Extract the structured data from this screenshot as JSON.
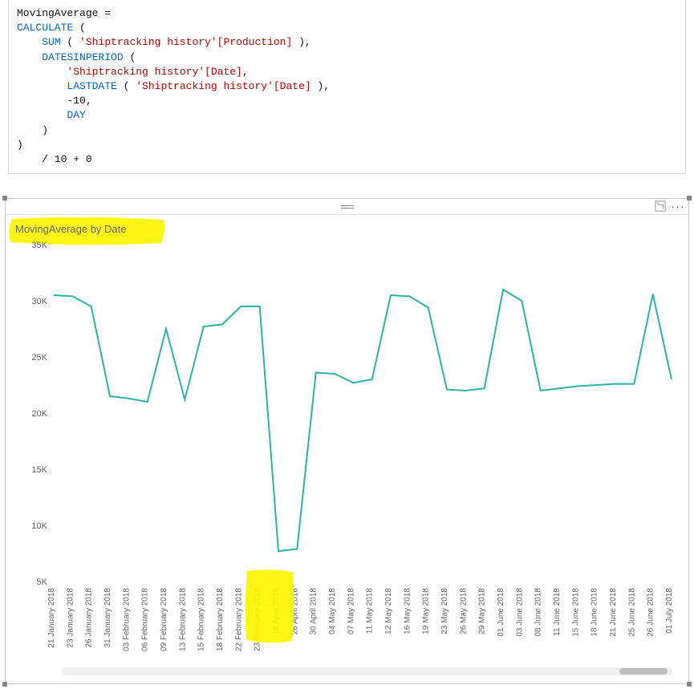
{
  "formula": {
    "line1_a": "MovingAverage",
    "line1_b": " = ",
    "line2_fn": "CALCULATE",
    "line2_b": " (",
    "line3_fn": "SUM",
    "line3_b": " ( ",
    "line3_str": "'Shiptracking history'[Production]",
    "line3_c": " ),",
    "line4_fn": "DATESINPERIOD",
    "line4_b": " (",
    "line5_str": "'Shiptracking history'[Date]",
    "line5_b": ",",
    "line6_fn": "LASTDATE",
    "line6_b": " ( ",
    "line6_str": "'Shiptracking history'[Date]",
    "line6_c": " ),",
    "line7_a": "-10,",
    "line8_fn": "DAY",
    "line9_a": ")",
    "line10_a": ")",
    "line11_a": "/ 10 + 0"
  },
  "visual": {
    "title": "MovingAverage by Date"
  },
  "chart_data": {
    "type": "line",
    "title": "MovingAverage by Date",
    "xlabel": "",
    "ylabel": "",
    "ylim": [
      5000,
      35000
    ],
    "y_ticks": [
      5000,
      10000,
      15000,
      20000,
      25000,
      30000,
      35000
    ],
    "y_tick_labels": [
      "5K",
      "10K",
      "15K",
      "20K",
      "25K",
      "30K",
      "35K"
    ],
    "categories": [
      "21 January 2018",
      "23 January 2018",
      "26 January 2018",
      "31 January 2018",
      "03 February 2018",
      "06 February 2018",
      "09 February 2018",
      "13 February 2018",
      "15 February 2018",
      "18 February 2018",
      "22 February 2018",
      "23 February 2018",
      "16 April 2018",
      "26 April 2018",
      "30 April 2018",
      "04 May 2018",
      "07 May 2018",
      "11 May 2018",
      "12 May 2018",
      "16 May 2018",
      "19 May 2018",
      "23 May 2018",
      "26 May 2018",
      "29 May 2018",
      "01 June 2018",
      "03 June 2018",
      "08 June 2018",
      "11 June 2018",
      "15 June 2018",
      "18 June 2018",
      "21 June 2018",
      "25 June 2018",
      "26 June 2018",
      "01 July 2018"
    ],
    "values": [
      30500,
      30400,
      29500,
      21500,
      21300,
      21000,
      27500,
      21200,
      27700,
      27900,
      29500,
      29500,
      7700,
      7900,
      23600,
      23500,
      22700,
      23000,
      30500,
      30400,
      29400,
      22100,
      22000,
      22200,
      31000,
      30000,
      22000,
      22200,
      22400,
      22500,
      22600,
      22600,
      30600,
      23000
    ],
    "line_color": "#2bb5a3"
  }
}
